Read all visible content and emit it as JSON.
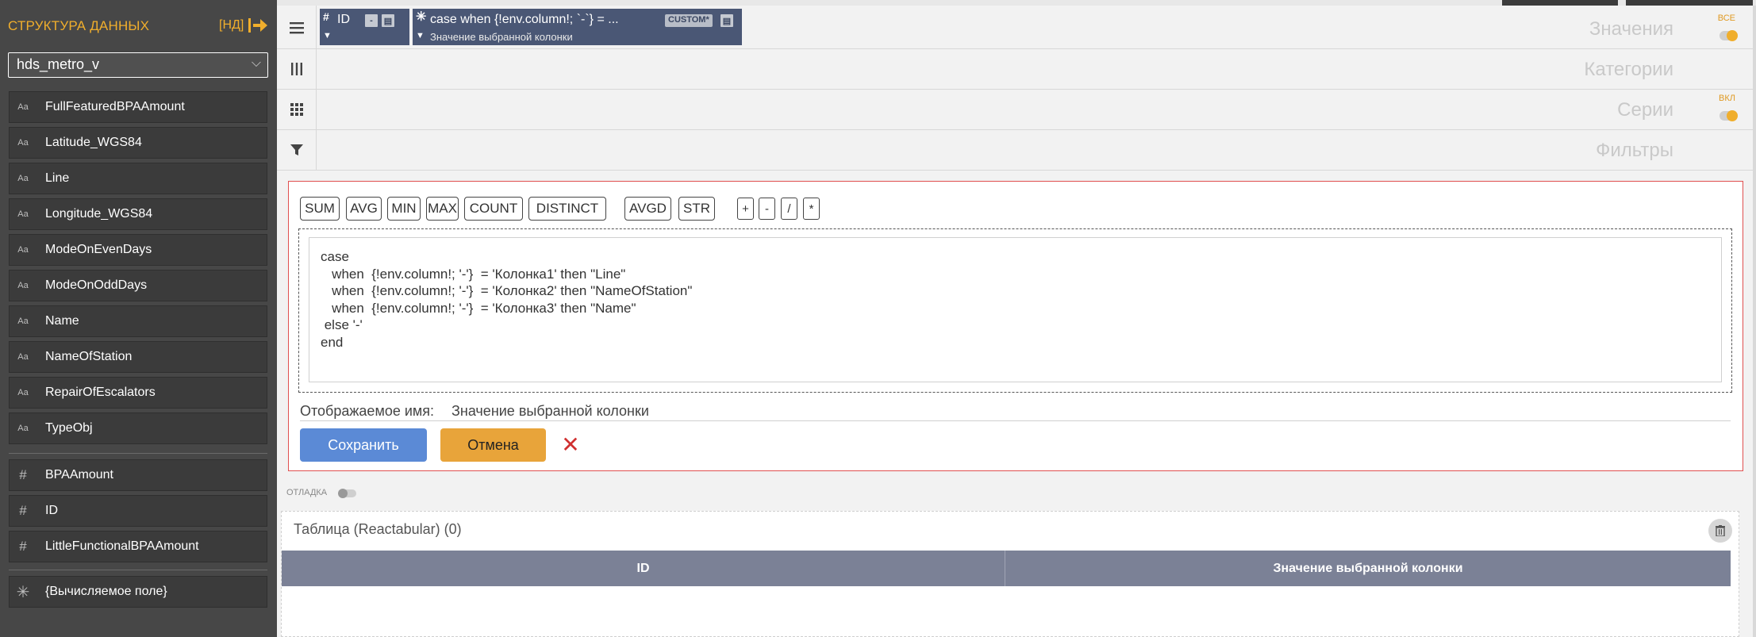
{
  "sidebar": {
    "title": "СТРУКТУРА ДАННЫХ",
    "nd_label": "[НД]",
    "dataset": "hds_metro_v",
    "text_fields": [
      {
        "icon": "text-type-icon",
        "glyph": "Aa",
        "label": "FullFeaturedBPAAmount"
      },
      {
        "icon": "text-type-icon",
        "glyph": "Aa",
        "label": "Latitude_WGS84"
      },
      {
        "icon": "text-type-icon",
        "glyph": "Aa",
        "label": "Line"
      },
      {
        "icon": "text-type-icon",
        "glyph": "Aa",
        "label": "Longitude_WGS84"
      },
      {
        "icon": "text-type-icon",
        "glyph": "Aa",
        "label": "ModeOnEvenDays"
      },
      {
        "icon": "text-type-icon",
        "glyph": "Aa",
        "label": "ModeOnOddDays"
      },
      {
        "icon": "text-type-icon",
        "glyph": "Aa",
        "label": "Name"
      },
      {
        "icon": "text-type-icon",
        "glyph": "Aa",
        "label": "NameOfStation"
      },
      {
        "icon": "text-type-icon",
        "glyph": "Aa",
        "label": "RepairOfEscalators"
      },
      {
        "icon": "text-type-icon",
        "glyph": "Aa",
        "label": "TypeObj"
      }
    ],
    "numeric_fields": [
      {
        "icon": "hash-icon",
        "glyph": "#",
        "label": "BPAAmount"
      },
      {
        "icon": "hash-icon",
        "glyph": "#",
        "label": "ID"
      },
      {
        "icon": "hash-icon",
        "glyph": "#",
        "label": "LittleFunctionalBPAAmount"
      }
    ],
    "calc_fields": [
      {
        "icon": "asterisk-icon",
        "glyph": "✳",
        "label": "{Вычисляемое поле}"
      }
    ]
  },
  "shelves": {
    "values": {
      "label": "Значения",
      "tag": "ВСЕ"
    },
    "categories": {
      "label": "Категории"
    },
    "series": {
      "label": "Серии",
      "tag": "ВКЛ"
    },
    "filters": {
      "label": "Фильтры"
    }
  },
  "pills": [
    {
      "type_glyph": "#",
      "name": "ID",
      "sub": "",
      "badge": "",
      "minus": "-"
    },
    {
      "type_glyph": "✳",
      "name": "case when {!env.column!; `-`} = ...",
      "sub": "Значение выбранной колонки",
      "badge": "CUSTOM*",
      "minus": ""
    }
  ],
  "editor": {
    "functions": [
      "SUM",
      "AVG",
      "MIN",
      "MAX",
      "COUNT",
      "DISTINCT",
      "AVGD",
      "STR",
      "+",
      "-",
      "/",
      "*"
    ],
    "code_lines": [
      "case",
      "   when  {!env.column!; '-'}  = 'Колонка1' then \"Line\"",
      "   when  {!env.column!; '-'}  = 'Колонка2' then \"NameOfStation\"",
      "   when  {!env.column!; '-'}  = 'Колонка3' then \"Name\"",
      " else '-'",
      "end"
    ],
    "display_name_label": "Отображаемое имя:",
    "display_name_value": "Значение выбранной колонки",
    "save_label": "Сохранить",
    "cancel_label": "Отмена"
  },
  "debug": {
    "label": "ОТЛАДКА"
  },
  "table": {
    "title": "Таблица (Reactabular) (0)",
    "columns": [
      "ID",
      "Значение выбранной колонки"
    ]
  }
}
